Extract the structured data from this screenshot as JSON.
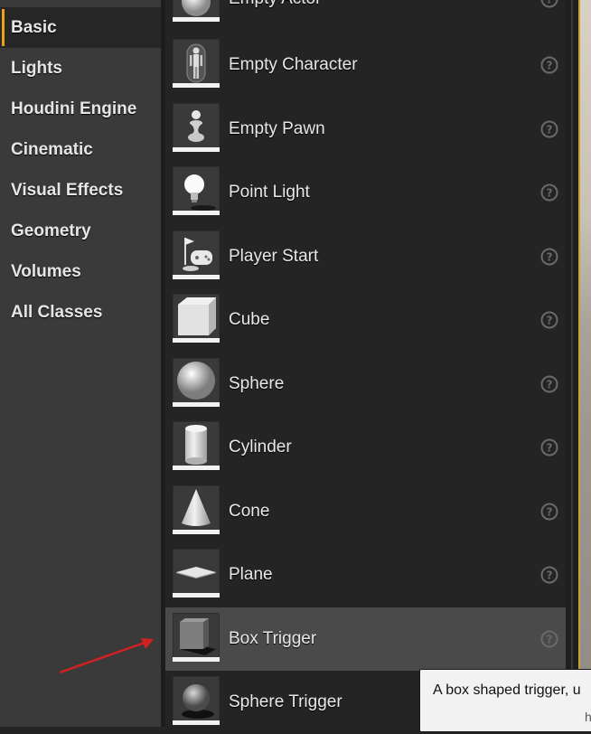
{
  "categories": [
    {
      "label": "Basic",
      "active": true
    },
    {
      "label": "Lights",
      "active": false
    },
    {
      "label": "Houdini Engine",
      "active": false
    },
    {
      "label": "Cinematic",
      "active": false
    },
    {
      "label": "Visual Effects",
      "active": false
    },
    {
      "label": "Geometry",
      "active": false
    },
    {
      "label": "Volumes",
      "active": false
    },
    {
      "label": "All Classes",
      "active": false
    }
  ],
  "items": [
    {
      "label": "Empty Actor",
      "icon": "empty-actor-icon"
    },
    {
      "label": "Empty Character",
      "icon": "empty-character-icon"
    },
    {
      "label": "Empty Pawn",
      "icon": "empty-pawn-icon"
    },
    {
      "label": "Point Light",
      "icon": "point-light-icon"
    },
    {
      "label": "Player Start",
      "icon": "player-start-icon"
    },
    {
      "label": "Cube",
      "icon": "cube-icon"
    },
    {
      "label": "Sphere",
      "icon": "sphere-icon"
    },
    {
      "label": "Cylinder",
      "icon": "cylinder-icon"
    },
    {
      "label": "Cone",
      "icon": "cone-icon"
    },
    {
      "label": "Plane",
      "icon": "plane-icon"
    },
    {
      "label": "Box Trigger",
      "icon": "box-trigger-icon",
      "highlighted": true
    },
    {
      "label": "Sphere Trigger",
      "icon": "sphere-trigger-icon"
    }
  ],
  "tooltip": {
    "text": "A box shaped trigger, u",
    "more": "h"
  },
  "colors": {
    "accent": "#e8a317",
    "annotation_arrow": "#d42020"
  }
}
